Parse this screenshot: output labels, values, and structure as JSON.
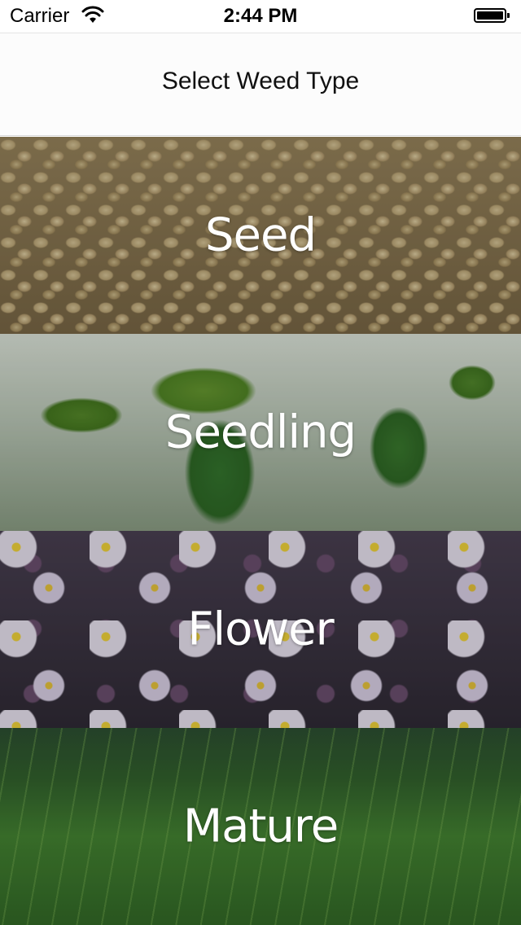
{
  "status_bar": {
    "carrier": "Carrier",
    "time": "2:44 PM",
    "battery_level": 1.0
  },
  "nav": {
    "title": "Select Weed Type"
  },
  "types": [
    {
      "label": "Seed",
      "image": "hemp-seeds-photo"
    },
    {
      "label": "Seedling",
      "image": "seedling-sprouts-photo"
    },
    {
      "label": "Flower",
      "image": "daisy-flowers-photo"
    },
    {
      "label": "Mature",
      "image": "tall-grass-field-photo"
    }
  ]
}
